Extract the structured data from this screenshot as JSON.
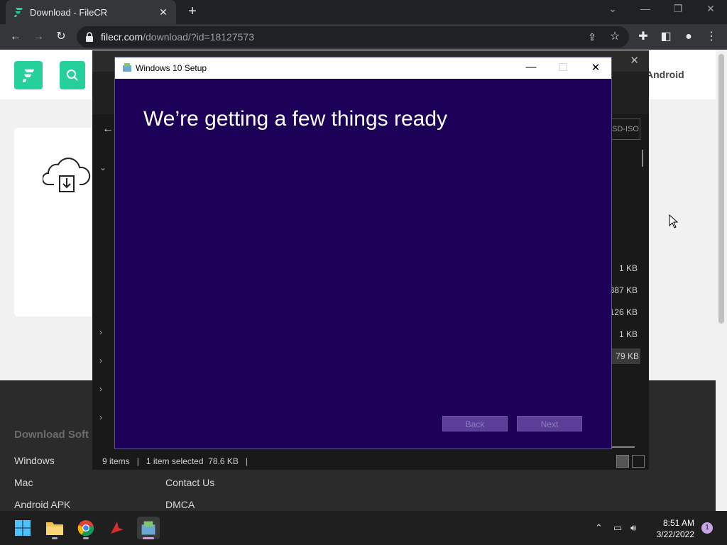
{
  "browser": {
    "tab_title": "Download - FileCR",
    "tab_close": "✕",
    "new_tab": "+",
    "url_host": "filecr.com",
    "url_path": "/download/?id=18127573"
  },
  "site": {
    "nav_android": "Android",
    "footer_heading": "Download Soft",
    "footer_col1": [
      "Windows",
      "Mac",
      "Android APK"
    ],
    "footer_col2": [
      "Contact Us",
      "DMCA"
    ],
    "brand_color": "#25d09a"
  },
  "explorer": {
    "tag": "SD-ISO",
    "sizes": [
      "1 KB",
      "387 KB",
      "126 KB",
      "1 KB",
      "79 KB"
    ],
    "status_items": "9 items",
    "status_selected": "1 item selected  78.6 KB"
  },
  "setup": {
    "title": "Windows 10 Setup",
    "heading": "We’re getting a few things ready",
    "back_label": "Back",
    "next_label": "Next",
    "bg_color": "#1c0058"
  },
  "taskbar": {
    "time": "8:51 AM",
    "date": "3/22/2022",
    "notification_count": "1"
  }
}
